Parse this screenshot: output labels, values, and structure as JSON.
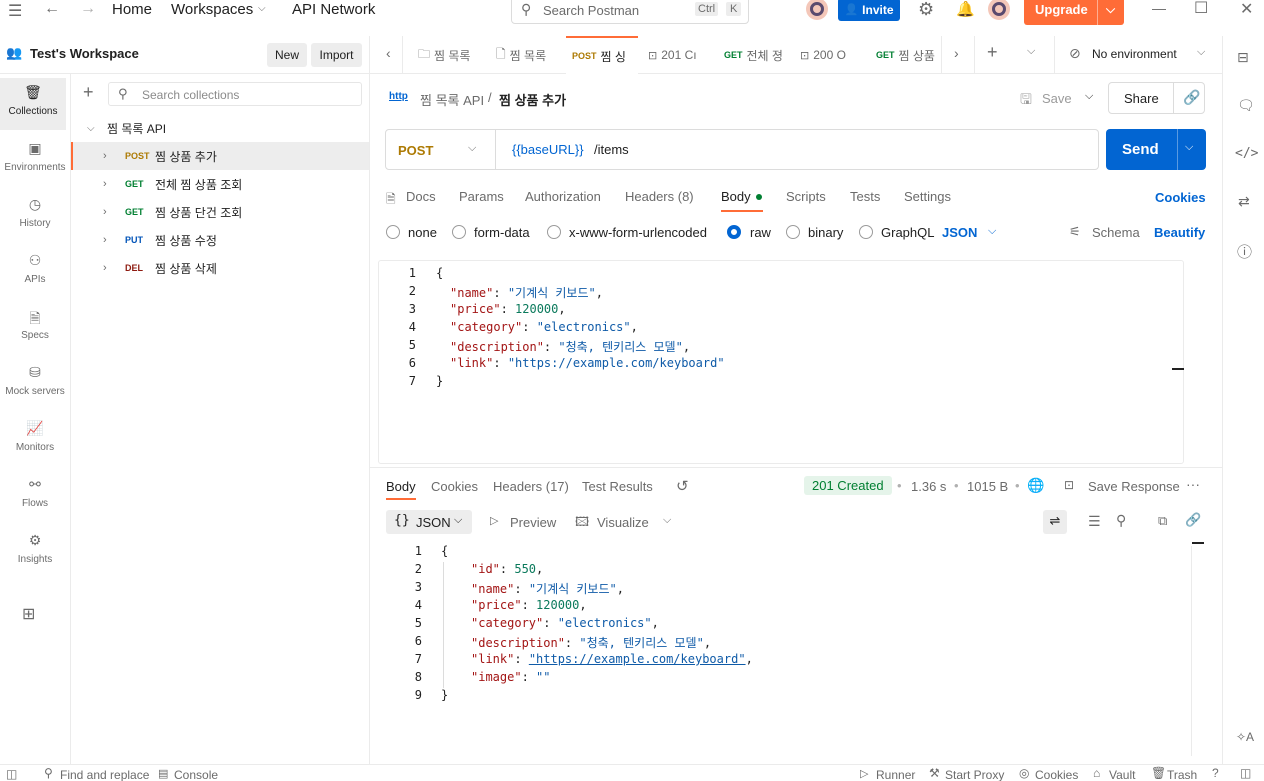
{
  "topnav": {
    "home": "Home",
    "workspaces": "Workspaces",
    "api_network": "API Network",
    "search_placeholder": "Search Postman",
    "search_kbd_ctrl": "Ctrl",
    "search_kbd_k": "K",
    "invite": "Invite",
    "upgrade": "Upgrade"
  },
  "workspace": {
    "name": "Test's Workspace",
    "new_btn": "New",
    "import_btn": "Import"
  },
  "rail": [
    {
      "label": "Collections",
      "icon": "collections-icon"
    },
    {
      "label": "Environments",
      "icon": "environments-icon"
    },
    {
      "label": "History",
      "icon": "history-icon"
    },
    {
      "label": "APIs",
      "icon": "apis-icon"
    },
    {
      "label": "Specs",
      "icon": "specs-icon"
    },
    {
      "label": "Mock servers",
      "icon": "mock-servers-icon"
    },
    {
      "label": "Monitors",
      "icon": "monitors-icon"
    },
    {
      "label": "Flows",
      "icon": "flows-icon"
    },
    {
      "label": "Insights",
      "icon": "insights-icon"
    }
  ],
  "sidebar": {
    "search_placeholder": "Search collections",
    "collection": "찜 목록 API",
    "requests": [
      {
        "method": "POST",
        "name": "찜 상품 추가"
      },
      {
        "method": "GET",
        "name": "전체 찜 상품 조회"
      },
      {
        "method": "GET",
        "name": "찜 상품 단건 조회"
      },
      {
        "method": "PUT",
        "name": "찜 상품 수정"
      },
      {
        "method": "DEL",
        "name": "찜 상품 삭제"
      }
    ]
  },
  "tabs": [
    {
      "prefix": "",
      "label": "찜 목록"
    },
    {
      "prefix": "",
      "label": "찜 목록"
    },
    {
      "prefix": "POST",
      "label": "찜 싱"
    },
    {
      "prefix": "",
      "label": "201 Cı"
    },
    {
      "prefix": "GET",
      "label": "전체 졍"
    },
    {
      "prefix": "",
      "label": "200 O"
    },
    {
      "prefix": "GET",
      "label": "찜 상품"
    }
  ],
  "environment": "No environment",
  "breadcrumb": {
    "collection": "찜 목록 API",
    "separator": "/",
    "request": "찜 상품 추가"
  },
  "actions": {
    "save": "Save",
    "share": "Share"
  },
  "request": {
    "method": "POST",
    "url_var": "{{baseURL}}",
    "url_path": " /items",
    "send": "Send"
  },
  "req_tabs": {
    "docs": "Docs",
    "params": "Params",
    "authorization": "Authorization",
    "headers": "Headers (8)",
    "body": "Body",
    "scripts": "Scripts",
    "tests": "Tests",
    "settings": "Settings",
    "cookies": "Cookies"
  },
  "body_types": {
    "none": "none",
    "form_data": "form-data",
    "urlencoded": "x-www-form-urlencoded",
    "raw": "raw",
    "binary": "binary",
    "graphql": "GraphQL",
    "json": "JSON",
    "schema": "Schema",
    "beautify": "Beautify"
  },
  "request_body": [
    {
      "n": "1",
      "text": "{"
    },
    {
      "n": "2",
      "key": "\"name\"",
      "val": "\"기계식 키보드\"",
      "type": "str",
      "comma": ","
    },
    {
      "n": "3",
      "key": "\"price\"",
      "val": "120000",
      "type": "num",
      "comma": ","
    },
    {
      "n": "4",
      "key": "\"category\"",
      "val": "\"electronics\"",
      "type": "str",
      "comma": ","
    },
    {
      "n": "5",
      "key": "\"description\"",
      "val": "\"청축, 텐키리스 모델\"",
      "type": "str",
      "comma": ","
    },
    {
      "n": "6",
      "key": "\"link\"",
      "val": "\"https://example.com/keyboard\"",
      "type": "str",
      "comma": ""
    },
    {
      "n": "7",
      "text": "}"
    }
  ],
  "resp_tabs": {
    "body": "Body",
    "cookies": "Cookies",
    "headers": "Headers (17)",
    "test_results": "Test Results"
  },
  "response": {
    "status": "201 Created",
    "time": "1.36 s",
    "size": "1015 B",
    "save_response": "Save Response",
    "format": "JSON",
    "preview": "Preview",
    "visualize": "Visualize",
    "dot": "•"
  },
  "response_body": [
    {
      "n": "1",
      "text": "{"
    },
    {
      "n": "2",
      "key": "\"id\"",
      "val": "550",
      "type": "num",
      "comma": ","
    },
    {
      "n": "3",
      "key": "\"name\"",
      "val": "\"기계식 키보드\"",
      "type": "str",
      "comma": ","
    },
    {
      "n": "4",
      "key": "\"price\"",
      "val": "120000",
      "type": "num",
      "comma": ","
    },
    {
      "n": "5",
      "key": "\"category\"",
      "val": "\"electronics\"",
      "type": "str",
      "comma": ","
    },
    {
      "n": "6",
      "key": "\"description\"",
      "val": "\"청축, 텐키리스 모델\"",
      "type": "str",
      "comma": ","
    },
    {
      "n": "7",
      "key": "\"link\"",
      "val": "\"https://example.com/keyboard\"",
      "type": "str",
      "comma": ","
    },
    {
      "n": "8",
      "key": "\"image\"",
      "val": "\"\"",
      "type": "str",
      "comma": ""
    },
    {
      "n": "9",
      "text": "}"
    }
  ],
  "statusbar": {
    "find_replace": "Find and replace",
    "console": "Console",
    "runner": "Runner",
    "start_proxy": "Start Proxy",
    "cookies": "Cookies",
    "vault": "Vault",
    "trash": "Trash"
  },
  "colors": {
    "accent": "#ff6c37",
    "primary": "#0265d2",
    "success": "#007f31"
  }
}
